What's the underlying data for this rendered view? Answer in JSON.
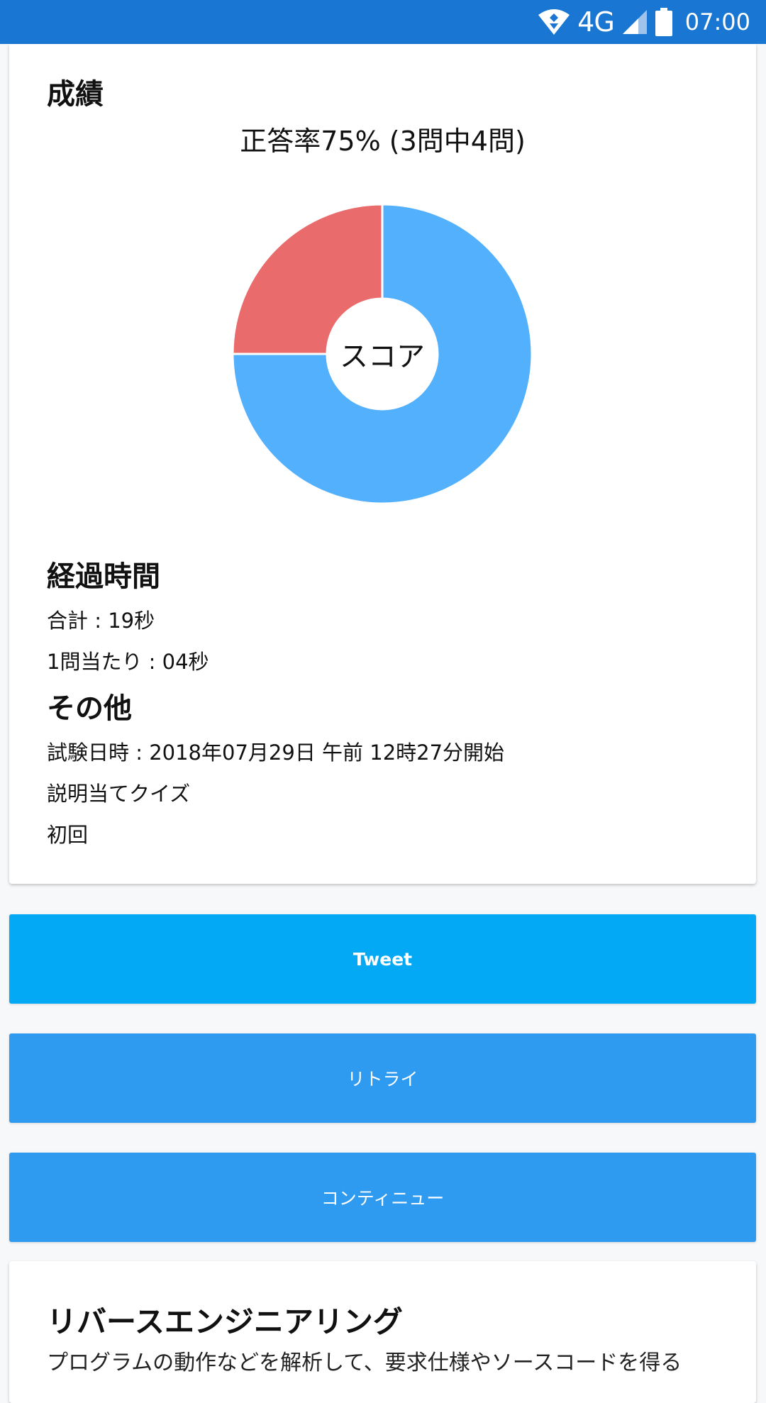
{
  "status_bar": {
    "network": "4G",
    "time": "07:00",
    "icons": [
      "wifi-icon",
      "cell-signal-icon",
      "battery-icon"
    ]
  },
  "results": {
    "heading": "成績",
    "score_caption": "正答率75% (3問中4問)",
    "donut_center": "スコア"
  },
  "elapsed": {
    "heading": "経過時間",
    "total": "合計 : 19秒",
    "per_question": "1問当たり : 04秒"
  },
  "other": {
    "heading": "その他",
    "exam_datetime": "試験日時 : 2018年07月29日 午前 12時27分開始",
    "quiz_type": "説明当てクイズ",
    "attempt": "初回"
  },
  "buttons": {
    "tweet": "Tweet",
    "retry": "リトライ",
    "continue": "コンティニュー"
  },
  "bottom_card": {
    "title": "リバースエンジニアリング",
    "desc": "プログラムの動作などを解析して、要求仕様やソースコードを得る"
  },
  "chart_data": {
    "type": "pie",
    "style": "donut",
    "center_label": "スコア",
    "slices": [
      {
        "value": 75,
        "color": "#52b0fd"
      },
      {
        "value": 25,
        "color": "#e96b6b"
      }
    ]
  },
  "colors": {
    "status_bar": "#1976d2",
    "tweet": "#03a9f4",
    "primary_button": "#2e9af0",
    "correct": "#52b0fd",
    "incorrect": "#e96b6b"
  }
}
